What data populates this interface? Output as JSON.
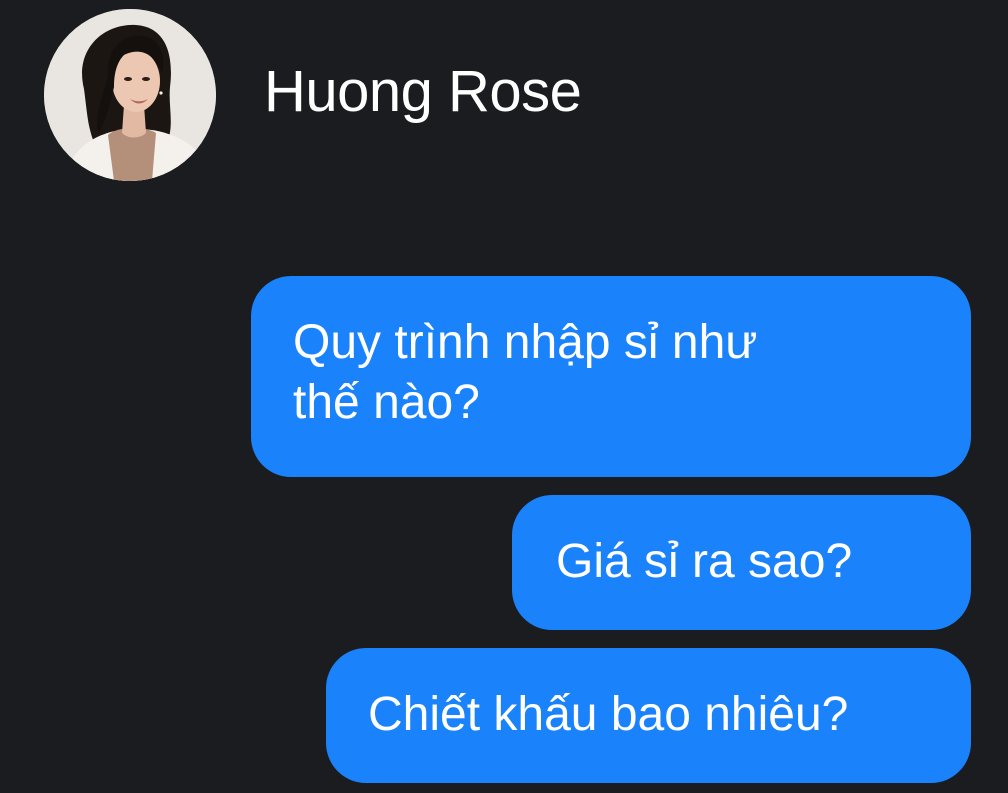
{
  "header": {
    "contact_name": "Huong Rose",
    "avatar": "profile-photo"
  },
  "messages": [
    {
      "sender": "me",
      "lines": [
        "Quy trình nhập sỉ như",
        "thế nào?"
      ]
    },
    {
      "sender": "me",
      "text": "Giá sỉ ra sao?"
    },
    {
      "sender": "me",
      "text": "Chiết khấu bao nhiêu?"
    }
  ],
  "colors": {
    "background": "#1b1c1f",
    "bubble_outgoing": "#1a82fb",
    "text": "#ffffff"
  }
}
